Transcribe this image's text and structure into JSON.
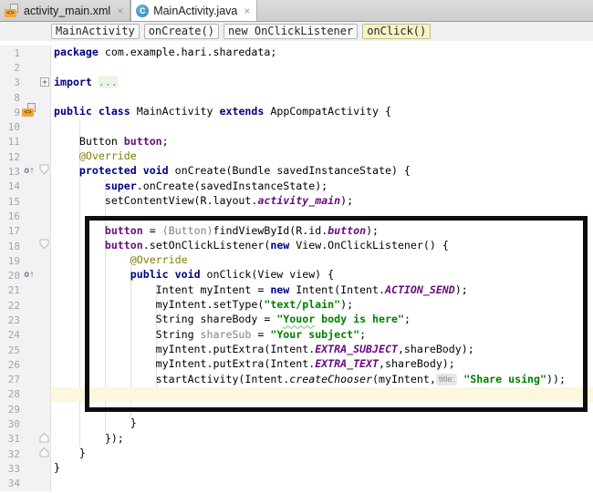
{
  "window": {
    "app": "Android Studio editor"
  },
  "icons": {
    "close": "×",
    "override_circle": "o",
    "override_arrow": "↑",
    "layout_badge": "<>",
    "class_letter": "C",
    "fold_plus": "+"
  },
  "colors": {
    "keyword": "#000080",
    "string": "#008000",
    "field": "#660E7A",
    "annotation": "#808000",
    "unused": "#808080",
    "caret_line_highlight": "#FCF7DD",
    "folded_bg": "#E9F5E5",
    "breadcrumb_highlight": "#F8F2C5",
    "annotation_box": "#0E0E0E",
    "class_icon": "#3A85BB",
    "layout_badge": "#F2A63B"
  },
  "tabs": [
    {
      "label": "activity_main.xml",
      "icon": "layout-file-icon",
      "active": false
    },
    {
      "label": "MainActivity.java",
      "icon": "java-class-icon",
      "active": true
    }
  ],
  "breadcrumbs": [
    {
      "label": "MainActivity",
      "highlighted": false
    },
    {
      "label": "onCreate()",
      "highlighted": false
    },
    {
      "label": "new OnClickListener",
      "highlighted": false
    },
    {
      "label": "onClick()",
      "highlighted": true
    }
  ],
  "editor": {
    "lines": [
      {
        "num": 1,
        "segs": [
          [
            "kw",
            "package"
          ],
          [
            "pl",
            " com.example.hari.sharedata;"
          ]
        ]
      },
      {
        "num": 2,
        "segs": []
      },
      {
        "num": 3,
        "fold": "plus",
        "segs": [
          [
            "kw",
            "import"
          ],
          [
            "pl",
            " "
          ],
          [
            "folded",
            "..."
          ]
        ]
      },
      {
        "num": 8,
        "segs": []
      },
      {
        "num": 9,
        "gicon": "layout",
        "segs": [
          [
            "kw",
            "public class"
          ],
          [
            "pl",
            " MainActivity "
          ],
          [
            "kw",
            "extends"
          ],
          [
            "pl",
            " AppCompatActivity {"
          ]
        ]
      },
      {
        "num": 10,
        "segs": []
      },
      {
        "num": 11,
        "segs": [
          [
            "pl",
            "    Button "
          ],
          [
            "field",
            "button"
          ],
          [
            "pl",
            ";"
          ]
        ]
      },
      {
        "num": 12,
        "segs": [
          [
            "pl",
            "    "
          ],
          [
            "ann",
            "@Override"
          ]
        ]
      },
      {
        "num": 13,
        "gicon": "override",
        "fold": "open",
        "segs": [
          [
            "pl",
            "    "
          ],
          [
            "kw",
            "protected void"
          ],
          [
            "pl",
            " onCreate(Bundle savedInstanceState) {"
          ]
        ]
      },
      {
        "num": 14,
        "segs": [
          [
            "pl",
            "        "
          ],
          [
            "kw",
            "super"
          ],
          [
            "pl",
            ".onCreate(savedInstanceState);"
          ]
        ]
      },
      {
        "num": 15,
        "segs": [
          [
            "pl",
            "        setContentView(R.layout."
          ],
          [
            "staticf",
            "activity_main"
          ],
          [
            "pl",
            ");"
          ]
        ]
      },
      {
        "num": 16,
        "segs": []
      },
      {
        "num": 17,
        "segs": [
          [
            "pl",
            "        "
          ],
          [
            "field",
            "button"
          ],
          [
            "pl",
            " = "
          ],
          [
            "gray",
            "(Button)"
          ],
          [
            "pl",
            "findViewById(R.id."
          ],
          [
            "staticf",
            "button"
          ],
          [
            "pl",
            ");"
          ]
        ]
      },
      {
        "num": 18,
        "fold": "open",
        "segs": [
          [
            "pl",
            "        "
          ],
          [
            "field",
            "button"
          ],
          [
            "pl",
            ".setOnClickListener("
          ],
          [
            "kw",
            "new"
          ],
          [
            "pl",
            " View.OnClickListener() {"
          ]
        ]
      },
      {
        "num": 19,
        "segs": [
          [
            "pl",
            "            "
          ],
          [
            "ann",
            "@Override"
          ]
        ]
      },
      {
        "num": 20,
        "gicon": "override",
        "segs": [
          [
            "pl",
            "            "
          ],
          [
            "kw",
            "public void"
          ],
          [
            "pl",
            " onClick(View view) {"
          ]
        ]
      },
      {
        "num": 21,
        "segs": [
          [
            "pl",
            "                Intent myIntent = "
          ],
          [
            "kw",
            "new"
          ],
          [
            "pl",
            " Intent(Intent."
          ],
          [
            "staticf",
            "ACTION_SEND"
          ],
          [
            "pl",
            ");"
          ]
        ]
      },
      {
        "num": 22,
        "segs": [
          [
            "pl",
            "                myIntent.setType("
          ],
          [
            "str",
            "\"text/plain\""
          ],
          [
            "pl",
            ");"
          ]
        ]
      },
      {
        "num": 23,
        "segs": [
          [
            "pl",
            "                String shareBody = "
          ],
          [
            "str",
            "\""
          ],
          [
            "typo",
            "Youor"
          ],
          [
            "str",
            " body is here\""
          ],
          [
            "pl",
            ";"
          ]
        ]
      },
      {
        "num": 24,
        "segs": [
          [
            "pl",
            "                String "
          ],
          [
            "gray",
            "shareSub"
          ],
          [
            "pl",
            " = "
          ],
          [
            "str",
            "\"Your subject\""
          ],
          [
            "pl",
            ";"
          ]
        ]
      },
      {
        "num": 25,
        "segs": [
          [
            "pl",
            "                myIntent.putExtra(Intent."
          ],
          [
            "staticf",
            "EXTRA_SUBJECT"
          ],
          [
            "pl",
            ",shareBody);"
          ]
        ]
      },
      {
        "num": 26,
        "segs": [
          [
            "pl",
            "                myIntent.putExtra(Intent."
          ],
          [
            "staticf",
            "EXTRA_TEXT"
          ],
          [
            "pl",
            ",shareBody);"
          ]
        ]
      },
      {
        "num": 27,
        "segs": [
          [
            "pl",
            "                startActivity(Intent."
          ],
          [
            "itm",
            "createChooser"
          ],
          [
            "pl",
            "(myIntent,"
          ],
          [
            "inlay",
            "title:"
          ],
          [
            "pl",
            " "
          ],
          [
            "str",
            "\"Share using\""
          ],
          [
            "pl",
            "));"
          ]
        ]
      },
      {
        "num": 28,
        "highlight": true,
        "segs": []
      },
      {
        "num": 29,
        "segs": []
      },
      {
        "num": 30,
        "segs": [
          [
            "pl",
            "            }"
          ]
        ]
      },
      {
        "num": 31,
        "fold": "close",
        "segs": [
          [
            "pl",
            "        });"
          ]
        ]
      },
      {
        "num": 32,
        "fold": "close",
        "segs": [
          [
            "pl",
            "    }"
          ]
        ]
      },
      {
        "num": 33,
        "segs": [
          [
            "pl",
            "}"
          ]
        ]
      },
      {
        "num": 34,
        "segs": []
      }
    ]
  }
}
